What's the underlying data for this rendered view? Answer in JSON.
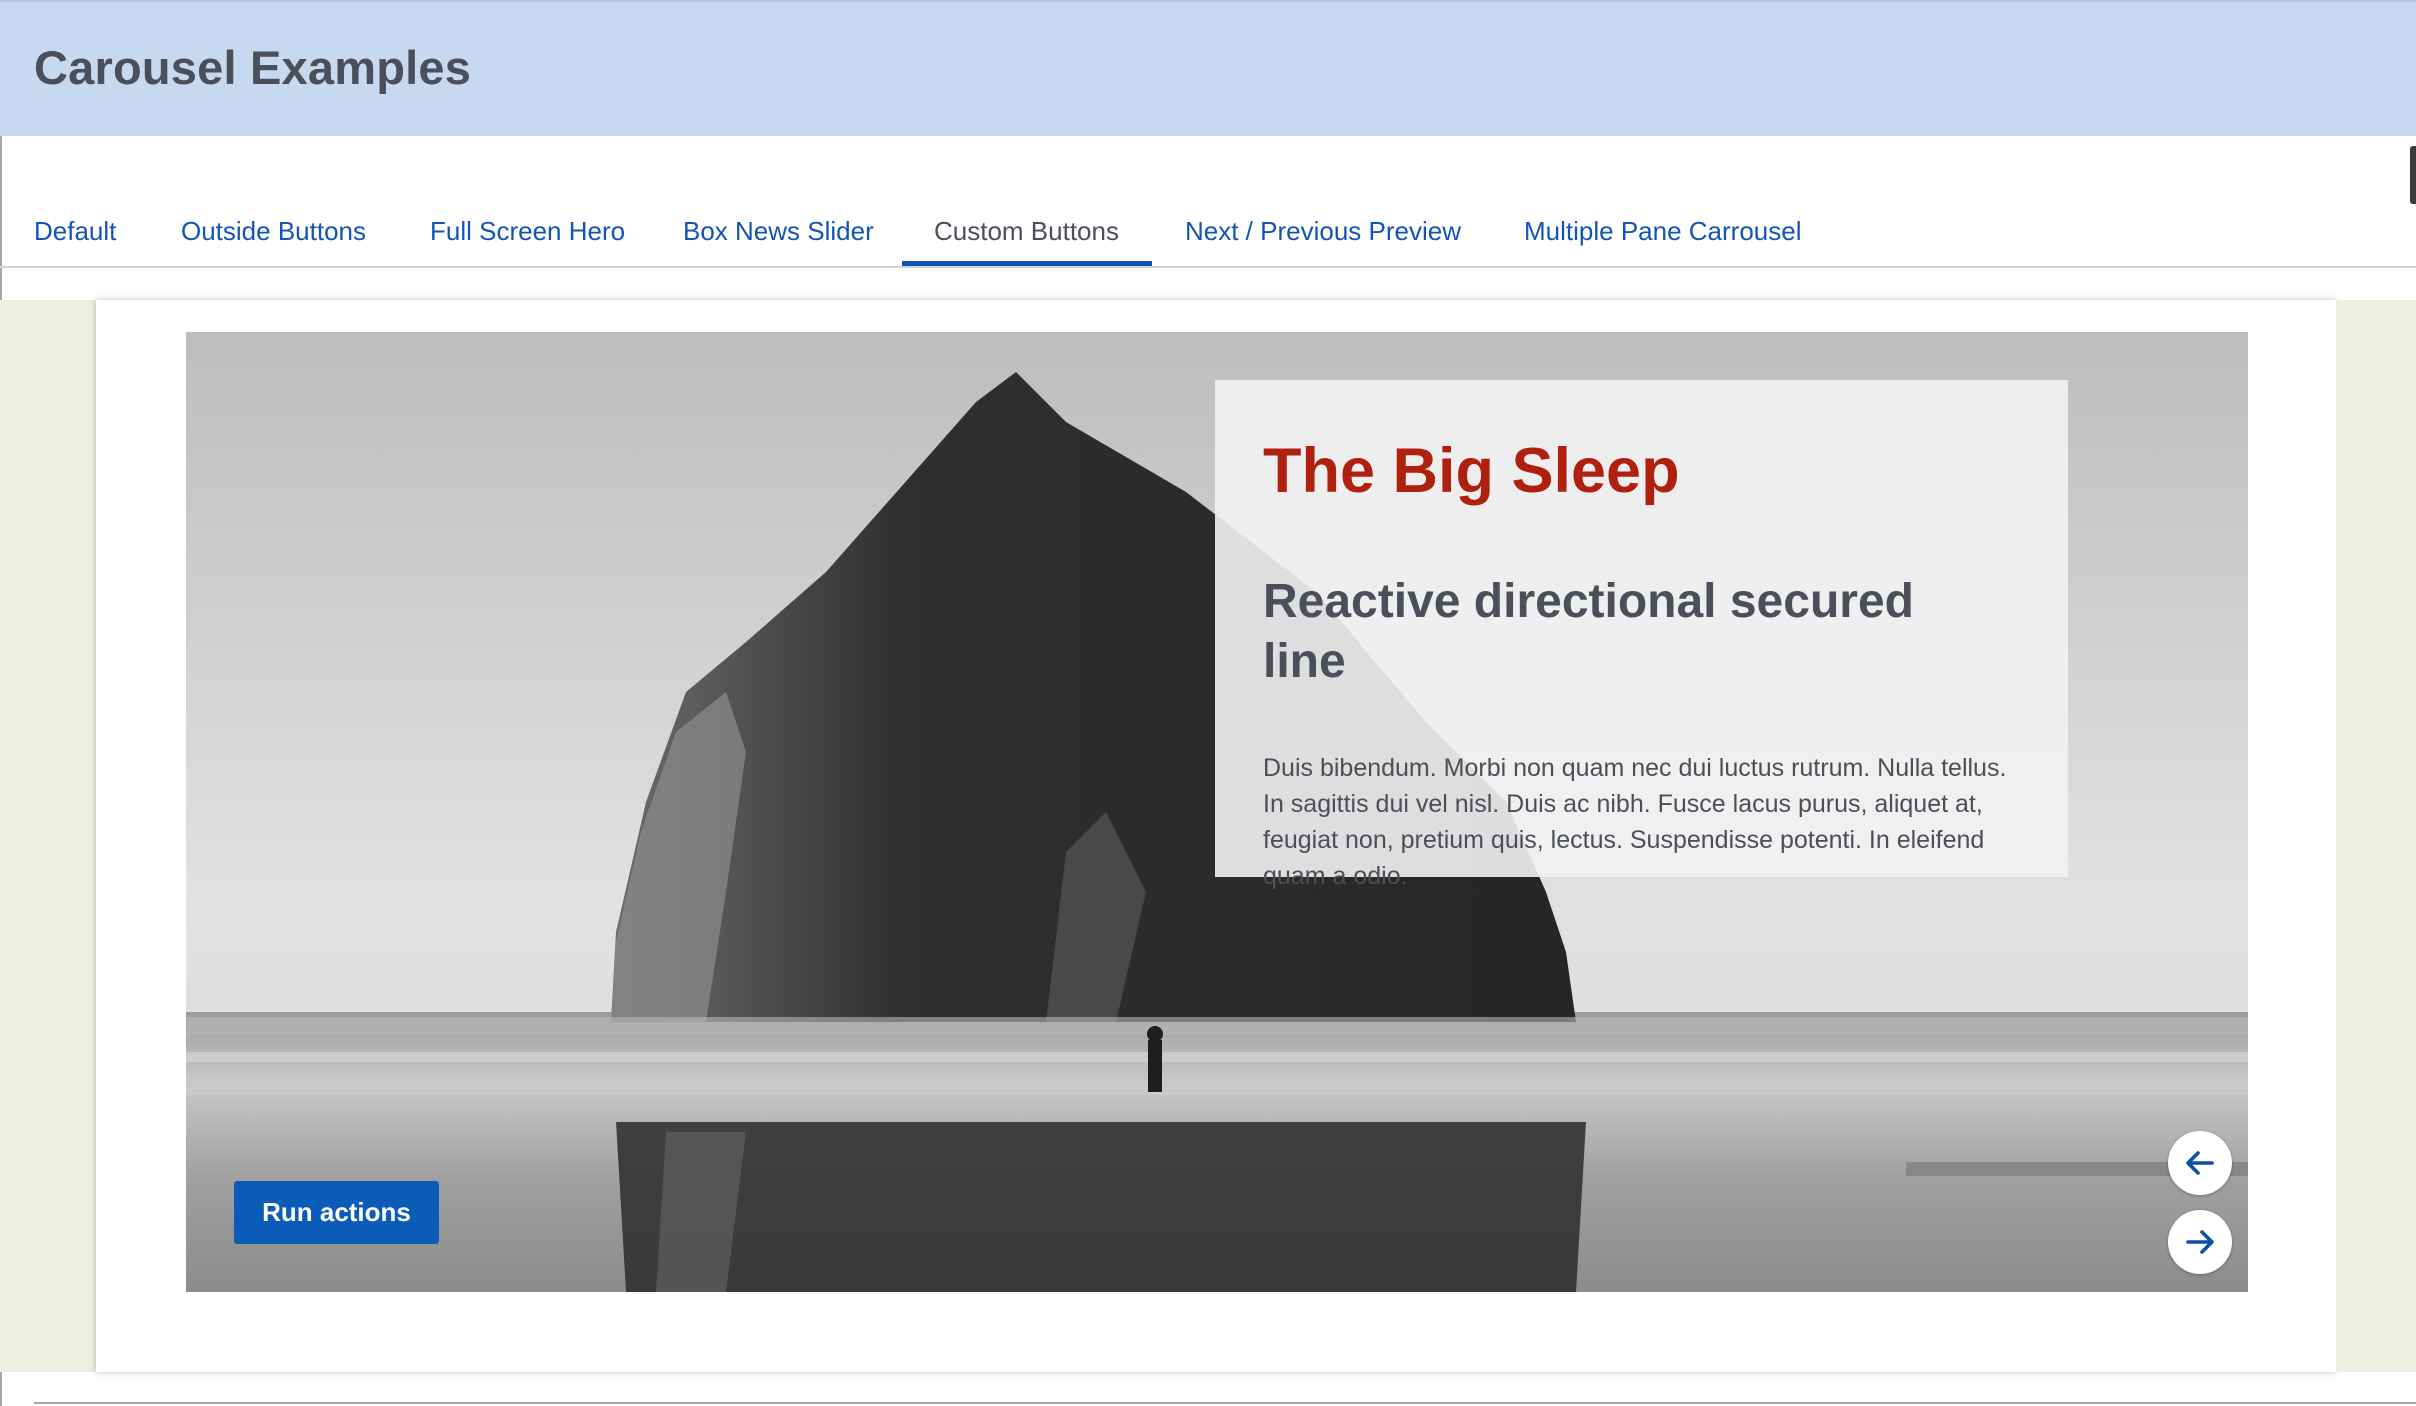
{
  "header": {
    "title": "Carousel Examples"
  },
  "tabs": [
    {
      "label": "Default",
      "active": false
    },
    {
      "label": "Outside Buttons",
      "active": false
    },
    {
      "label": "Full Screen Hero",
      "active": false
    },
    {
      "label": "Box News Slider",
      "active": false
    },
    {
      "label": "Custom Buttons",
      "active": true
    },
    {
      "label": "Next / Previous Preview",
      "active": false
    },
    {
      "label": "Multiple Pane Carrousel",
      "active": false
    }
  ],
  "slide": {
    "image": "black-and-white-sea-stack-photo",
    "title": "The Big Sleep",
    "subtitle": "Reactive directional secured line",
    "body": "Duis bibendum. Morbi non quam nec dui luctus rutrum. Nulla tellus. In sagittis dui vel nisl. Duis ac nibh. Fusce lacus purus, aliquet at, feugiat non, pretium quis, lectus. Suspendisse potenti. In eleifend quam a odio.",
    "action_label": "Run actions"
  },
  "controls": {
    "prev_icon": "arrow-left-icon",
    "next_icon": "arrow-right-icon"
  },
  "colors": {
    "header_bg": "#c7d9f1",
    "link": "#1354b5",
    "accent": "#0b5cb8",
    "caption_title": "#b0200f",
    "side_panel": "#edf0e1"
  }
}
